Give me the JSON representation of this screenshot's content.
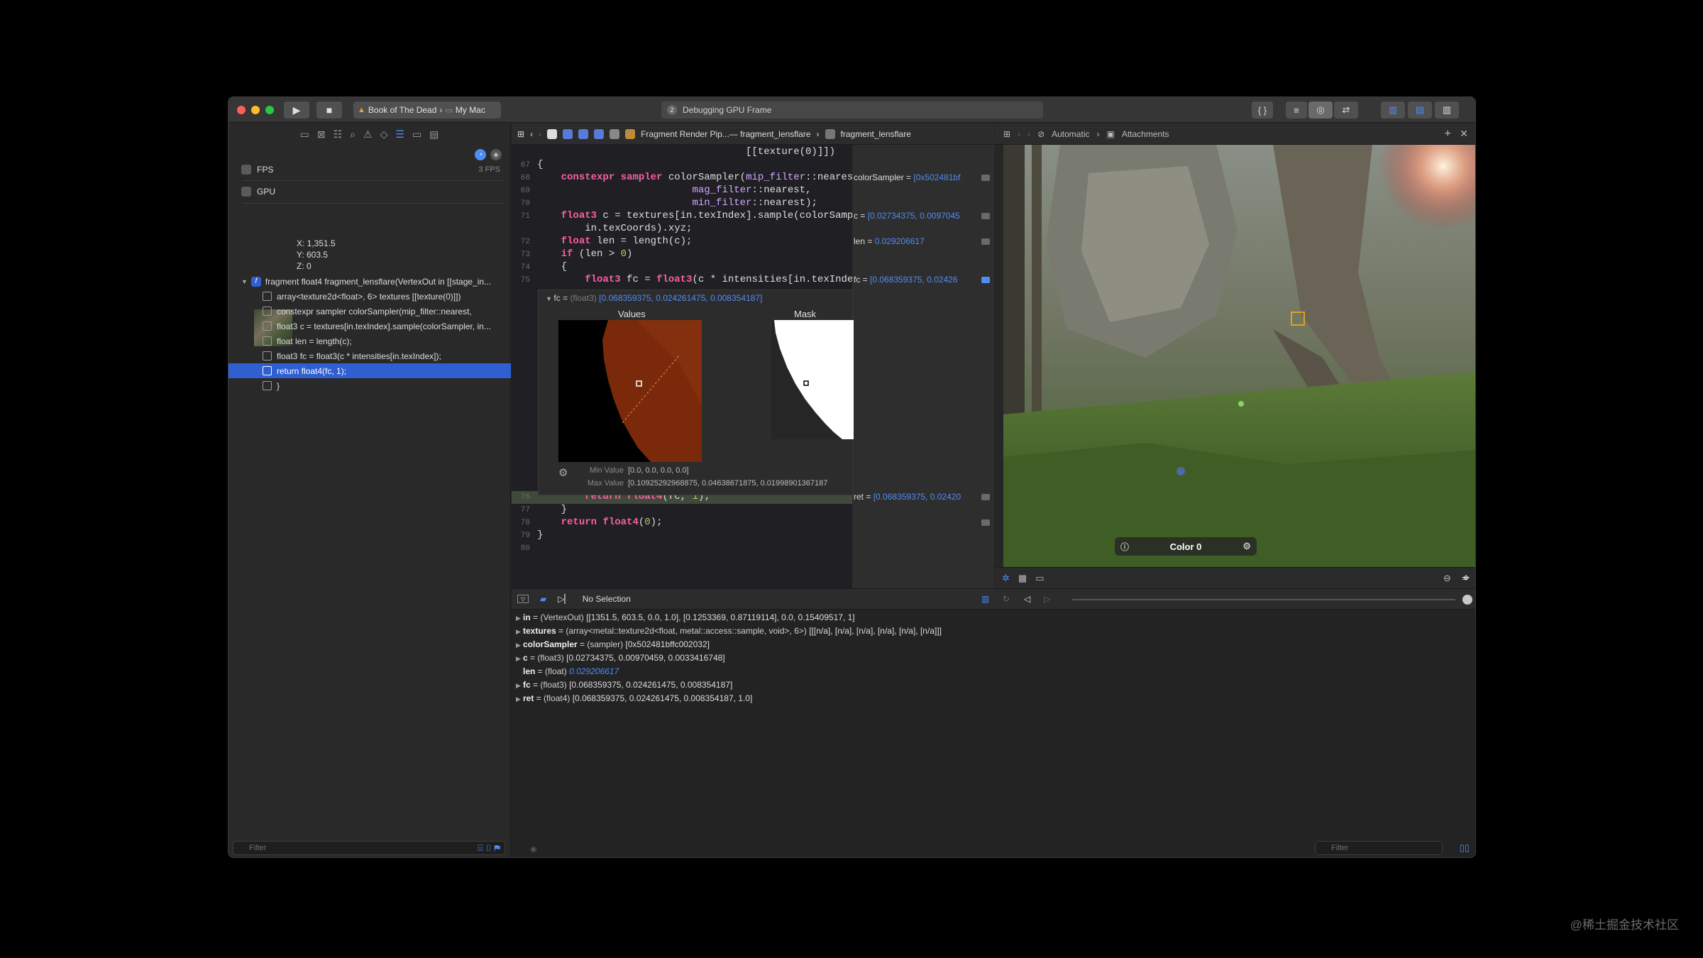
{
  "window": {
    "traffic_colors": [
      "#ff5f57",
      "#febc2e",
      "#28c840"
    ]
  },
  "toolbar": {
    "scheme_name": "Book of The Dead",
    "destination": "My Mac",
    "status_num": "2",
    "status_text": "Debugging GPU Frame"
  },
  "navigator": {
    "fps_label": "FPS",
    "fps_value": "3 FPS",
    "gpu_label": "GPU",
    "coords": {
      "x": "X:  1,351.5",
      "y": "Y:  603.5",
      "z": "Z:  0"
    },
    "tree": [
      "fragment float4 fragment_lensflare(VertexOut in [[stage_in...",
      "array<texture2d<float>, 6> textures [[texture(0)]])",
      "constexpr sampler colorSampler(mip_filter::nearest,",
      "float3 c = textures[in.texIndex].sample(colorSampler, in...",
      "float len = length(c);",
      "float3 fc = float3(c * intensities[in.texIndex]);",
      "return float4(fc, 1);",
      "}"
    ],
    "filter_placeholder": "Filter"
  },
  "jumpbar": {
    "crumb1": "Fragment Render Pip...— fragment_lensflare",
    "crumb2": "fragment_lensflare"
  },
  "code": {
    "top_partial": "[[texture(0)]])",
    "ln67": "67",
    "ln68": "68",
    "ln69": "69",
    "ln70": "70",
    "ln71": "71",
    "ln72": "72",
    "ln73": "73",
    "ln74": "74",
    "ln75": "75",
    "ln76": "76",
    "ln77": "77",
    "ln78": "78",
    "ln79": "79",
    "ln80": "80"
  },
  "results": {
    "colorSampler": "colorSampler = ",
    "colorSampler_val": "[0x502481bf",
    "c": "c = ",
    "c_val": "[0.02734375, 0.0097045",
    "len": "len = ",
    "len_val": "0.029206617",
    "fc": "fc = ",
    "fc_val": "[0.068359375, 0.02426",
    "ret": "ret = ",
    "ret_val": "[0.068359375, 0.02420"
  },
  "popover": {
    "head_name": "fc = ",
    "head_type": "(float3) ",
    "head_val": "[0.068359375, 0.024261475, 0.008354187]",
    "values_label": "Values",
    "mask_label": "Mask",
    "min_label": "Min Value",
    "min_val": "[0.0, 0.0, 0.0, 0.0]",
    "max_label": "Max Value",
    "max_val": "[0.10925292968875, 0.04638671875, 0.01998901367187"
  },
  "assistant": {
    "mode": "Automatic",
    "attachments": "Attachments",
    "color_label": "Color 0"
  },
  "debugbar": {
    "selection": "No Selection"
  },
  "variables": [
    {
      "name": "in",
      "type": "(VertexOut)",
      "value": "[[1351.5, 603.5, 0.0, 1.0], [0.1253369, 0.87119114], 0.0, 0.15409517, 1]"
    },
    {
      "name": "textures",
      "type": "(array<metal::texture2d<float, metal::access::sample, void>, 6>)",
      "value": "[[[n/a], [n/a], [n/a], [n/a], [n/a], [n/a]]]"
    },
    {
      "name": "colorSampler",
      "type": "(sampler)",
      "value": "[0x502481bffc002032]"
    },
    {
      "name": "c",
      "type": "(float3)",
      "value": "[0.02734375, 0.00970459, 0.0033416748]"
    },
    {
      "name": "len",
      "type": "(float)",
      "value": "0.029206617"
    },
    {
      "name": "fc",
      "type": "(float3)",
      "value": "[0.068359375, 0.024261475, 0.008354187]"
    },
    {
      "name": "ret",
      "type": "(float4)",
      "value": "[0.068359375, 0.024261475, 0.008354187, 1.0]"
    }
  ],
  "variables_filter": "Filter",
  "watermark": "@稀土掘金技术社区"
}
